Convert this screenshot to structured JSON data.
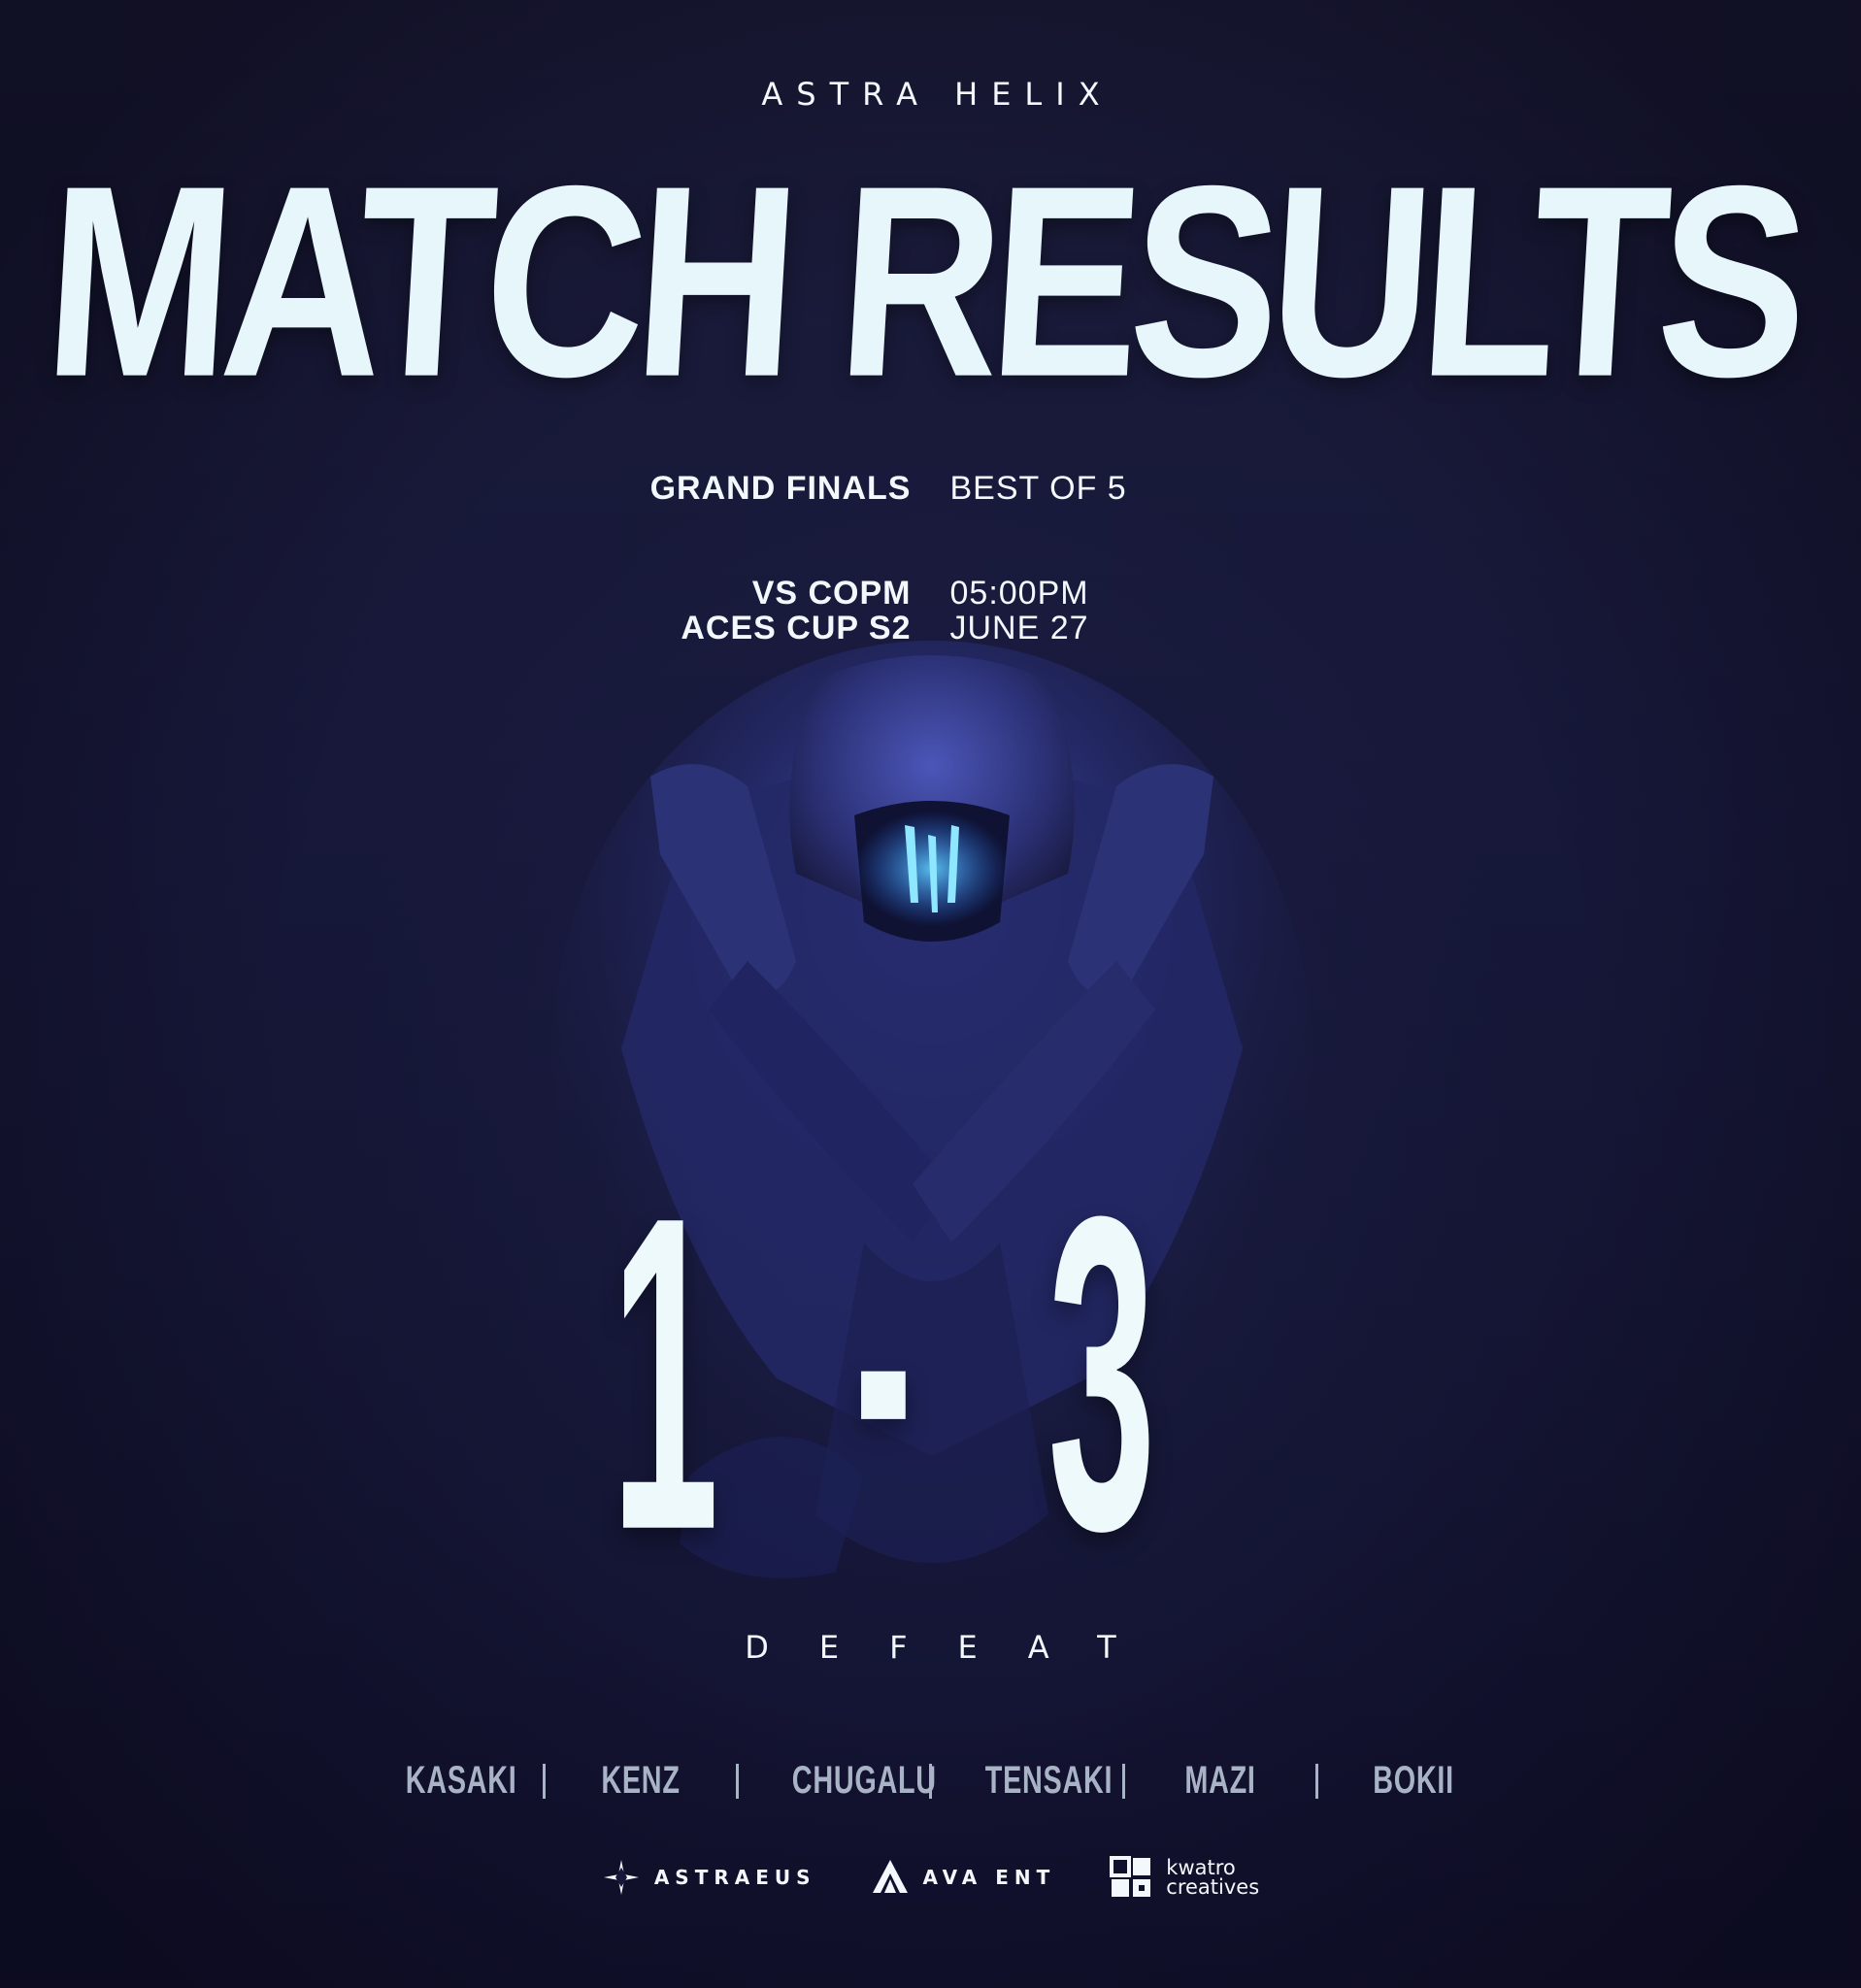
{
  "org": {
    "name": "ASTRA HELIX"
  },
  "title": "MATCH RESULTS",
  "stage": {
    "name": "GRAND FINALS",
    "format": "BEST OF 5"
  },
  "match": {
    "opponent": "VS COPM",
    "time": "05:00PM",
    "event": "ACES CUP S2",
    "date": "JUNE 27"
  },
  "score": {
    "team": "1",
    "separator": "-",
    "opponent": "3"
  },
  "result": "DEFEAT",
  "roster": [
    "KASAKI",
    "KENZ",
    "CHUGALU",
    "TENSAKI",
    "MAZI",
    "BOKII"
  ],
  "sponsors": {
    "astraeus": "ASTRAEUS",
    "ava": "AVA ENT",
    "kwatro_line1": "kwatro",
    "kwatro_line2": "creatives"
  },
  "colors": {
    "background": "#16173a",
    "text": "#e9f7fb",
    "roster_text": "#a9b3c6",
    "visor_glow": "#3fb6ff"
  },
  "icons": {
    "astraeus": "star-compass-icon",
    "ava": "ava-chevron-icon",
    "kwatro": "kwatro-blocks-icon"
  }
}
